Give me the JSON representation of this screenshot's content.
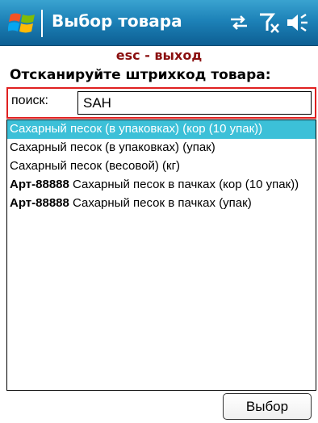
{
  "titlebar": {
    "title": "Выбор товара",
    "start_icon": "windows-start-icon",
    "status_icons": [
      "sync-arrows-icon",
      "no-signal-icon",
      "volume-icon"
    ]
  },
  "esc_hint": "esc - выход",
  "prompt": "Отсканируйте штрихкод товара:",
  "search": {
    "label": "поиск:",
    "value": "SAH"
  },
  "items": [
    {
      "article": "",
      "text": "Сахарный песок (в упаковках) (кор (10 упак))",
      "selected": true
    },
    {
      "article": "",
      "text": "Сахарный песок (в упаковках) (упак)",
      "selected": false
    },
    {
      "article": "",
      "text": "Сахарный песок (весовой) (кг)",
      "selected": false
    },
    {
      "article": "Арт-88888",
      "text": " Сахарный песок в пачках (кор (10 упак))",
      "selected": false
    },
    {
      "article": "Арт-88888",
      "text": " Сахарный песок в пачках (упак)",
      "selected": false
    }
  ],
  "select_button": "Выбор",
  "colors": {
    "titlebar": "#1d82b8",
    "selection": "#3cc0d8",
    "esc_hint": "#8b1010",
    "search_border": "#e02020"
  }
}
